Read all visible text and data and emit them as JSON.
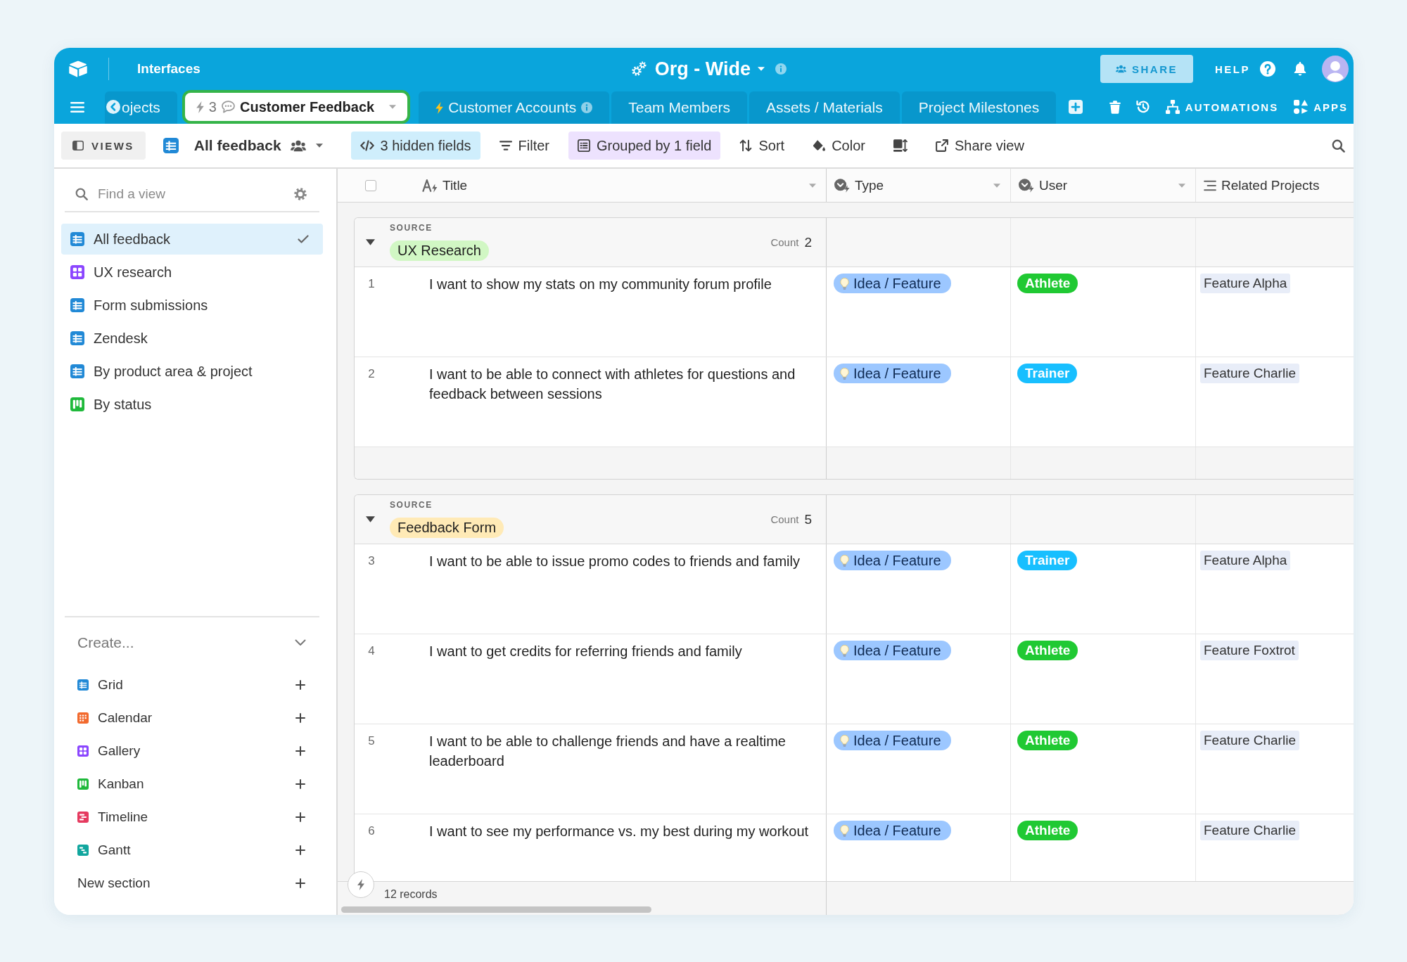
{
  "top_bar": {
    "section": "Interfaces",
    "base_name": "Org - Wide",
    "share": "SHARE",
    "help": "HELP"
  },
  "tabs": [
    {
      "label": "ojects",
      "selected": false,
      "bolt": false,
      "comment": false,
      "info": false
    },
    {
      "label": "Customer Feedback",
      "selected": true,
      "bolt": true,
      "badge": "3",
      "comment": true,
      "info": false
    },
    {
      "label": "Customer Accounts",
      "selected": false,
      "bolt": true,
      "comment": false,
      "info": true
    },
    {
      "label": "Team Members",
      "selected": false,
      "bolt": false,
      "comment": false,
      "info": false
    },
    {
      "label": "Assets / Materials",
      "selected": false,
      "bolt": false,
      "comment": false,
      "info": false
    },
    {
      "label": "Project Milestones",
      "selected": false,
      "bolt": false,
      "comment": false,
      "info": false
    }
  ],
  "tab_actions": [
    {
      "kind": "automations",
      "label": "AUTOMATIONS"
    },
    {
      "kind": "apps",
      "label": "APPS"
    }
  ],
  "toolbar": {
    "views": "VIEWS",
    "view_name": "All feedback",
    "buttons": [
      {
        "kind": "hidden_fields",
        "label": "3 hidden fields",
        "active": true
      },
      {
        "kind": "filter",
        "label": "Filter",
        "active": false
      },
      {
        "kind": "group",
        "label": "Grouped by 1 field",
        "active": true
      },
      {
        "kind": "sort",
        "label": "Sort",
        "active": false
      },
      {
        "kind": "color",
        "label": "Color",
        "active": false
      },
      {
        "kind": "row_height",
        "active": false
      },
      {
        "kind": "share_view",
        "label": "Share view",
        "active": false
      }
    ]
  },
  "sidebar": {
    "search_placeholder": "Find a view",
    "views": [
      {
        "name": "All feedback",
        "kind": "grid",
        "selected": true
      },
      {
        "name": "UX research",
        "kind": "gallery",
        "selected": false
      },
      {
        "name": "Form submissions",
        "kind": "grid",
        "selected": false
      },
      {
        "name": "Zendesk",
        "kind": "grid",
        "selected": false
      },
      {
        "name": "By product area & project",
        "kind": "grid",
        "selected": false
      },
      {
        "name": "By status",
        "kind": "kanban",
        "selected": false
      }
    ],
    "create_label": "Create...",
    "create_items": [
      {
        "name": "Grid",
        "kind": "grid"
      },
      {
        "name": "Calendar",
        "kind": "calendar"
      },
      {
        "name": "Gallery",
        "kind": "gallery"
      },
      {
        "name": "Kanban",
        "kind": "kanban"
      },
      {
        "name": "Timeline",
        "kind": "timeline"
      },
      {
        "name": "Gantt",
        "kind": "gantt"
      }
    ],
    "new_section": "New section"
  },
  "table": {
    "select_all": {
      "checked": false
    },
    "columns": [
      {
        "name": "Title",
        "kind": "text"
      },
      {
        "name": "Type",
        "kind": "select"
      },
      {
        "name": "User",
        "kind": "select"
      },
      {
        "name": "Related Projects",
        "kind": "link"
      }
    ],
    "groups": [
      {
        "field": "SOURCE",
        "value": "UX Research",
        "color": "#d1f7c4",
        "count_label": "Count",
        "count": "2",
        "expanded": true,
        "rows": [
          {
            "number": "1",
            "title": "I want to show my stats on my community forum profile",
            "type": "Idea / Feature",
            "user": {
              "label": "Athlete",
              "color": "#20c933"
            },
            "projects": [
              "Feature Alpha"
            ]
          },
          {
            "number": "2",
            "title": "I want to be able to connect with athletes for questions and feedback between sessions",
            "type": "Idea / Feature",
            "user": {
              "label": "Trainer",
              "color": "#18bfff"
            },
            "projects": [
              "Feature Charlie"
            ]
          }
        ]
      },
      {
        "field": "SOURCE",
        "value": "Feedback Form",
        "color": "#ffeab6",
        "count_label": "Count",
        "count": "5",
        "expanded": true,
        "rows": [
          {
            "number": "3",
            "title": "I want to be able to issue promo codes to friends and family",
            "type": "Idea / Feature",
            "user": {
              "label": "Trainer",
              "color": "#18bfff"
            },
            "projects": [
              "Feature Alpha"
            ]
          },
          {
            "number": "4",
            "title": "I want to get credits for referring friends and family",
            "type": "Idea / Feature",
            "user": {
              "label": "Athlete",
              "color": "#20c933"
            },
            "projects": [
              "Feature Foxtrot"
            ]
          },
          {
            "number": "5",
            "title": "I want to be able to challenge friends and have a realtime leaderboard",
            "type": "Idea / Feature",
            "user": {
              "label": "Athlete",
              "color": "#20c933"
            },
            "projects": [
              "Feature Charlie"
            ]
          },
          {
            "number": "6",
            "title": "I want to see my performance vs. my best during my workout",
            "type": "Idea / Feature",
            "user": {
              "label": "Athlete",
              "color": "#20c933"
            },
            "projects": [
              "Feature Charlie"
            ]
          }
        ]
      }
    ]
  },
  "footer": {
    "records": "12 records"
  }
}
